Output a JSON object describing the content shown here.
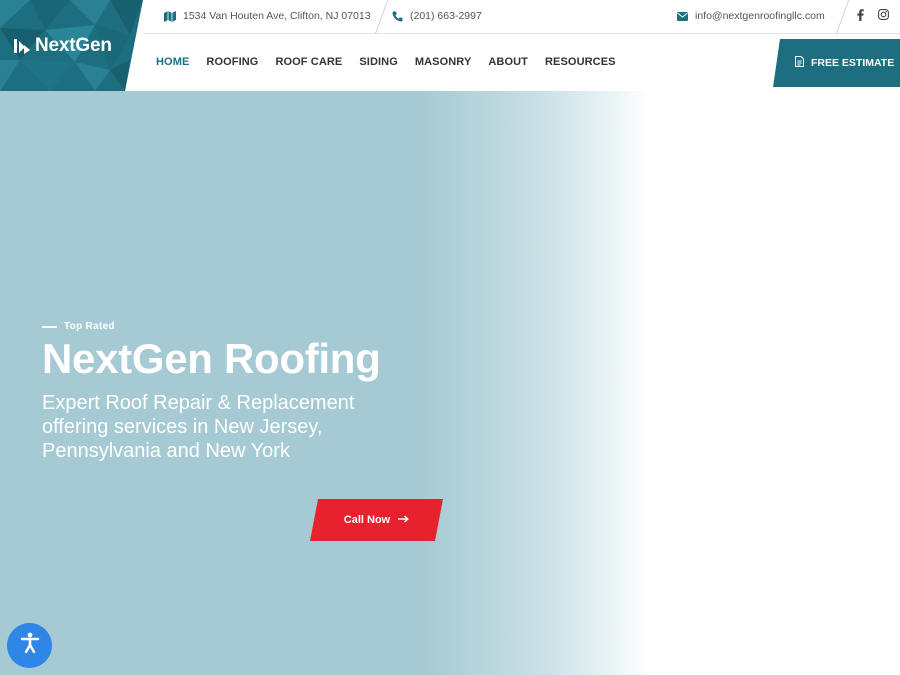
{
  "brand": {
    "name": "NextGen"
  },
  "topbar": {
    "address": "1534 Van Houten Ave, Clifton, NJ 07013",
    "phone": "(201) 663-2997",
    "email": "info@nextgenroofingllc.com"
  },
  "nav": {
    "items": [
      "HOME",
      "ROOFING",
      "ROOF CARE",
      "SIDING",
      "MASONRY",
      "ABOUT",
      "RESOURCES"
    ],
    "active": "HOME",
    "cta_label": "FREE ESTIMATE"
  },
  "hero": {
    "eyebrow": "Top Rated",
    "title": "NextGen Roofing",
    "subtitle": "Expert Roof Repair & Replacement offering services in New Jersey, Pennsylvania and New York",
    "button_label": "Call Now"
  },
  "icons": [
    "map-icon",
    "phone-icon",
    "envelope-icon",
    "facebook-icon",
    "instagram-icon",
    "document-icon",
    "arrow-right-icon",
    "accessibility-icon"
  ],
  "colors": {
    "primary": "#1d6f80",
    "accent": "#e8212e",
    "hero_bg": "#a6cad3",
    "accessibility": "#2f86e6"
  }
}
